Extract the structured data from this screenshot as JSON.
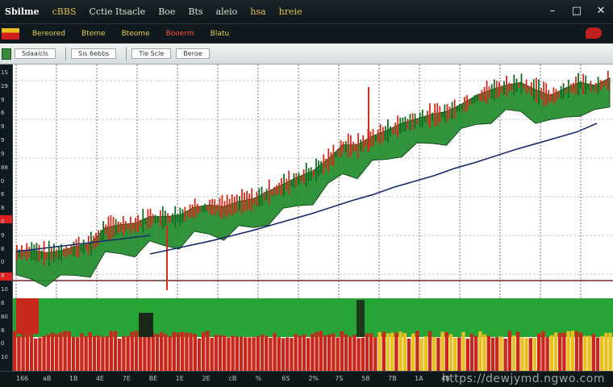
{
  "titlebar": {
    "menu": [
      "Sbilme",
      "cBBS",
      "Cctie Itsacle",
      "Boe",
      "Bts",
      "aleio",
      "hsa",
      "hreie"
    ],
    "controls": [
      "–",
      "□",
      "✕"
    ]
  },
  "toolbar1": {
    "items": [
      "Bereored",
      "Bteme",
      "Bteome",
      "Booerm",
      "Blatu"
    ],
    "icons": [
      "chart-color-swatch-icon",
      "close-panel-icon"
    ]
  },
  "toolbar2": {
    "fields": [
      "Sdaalcls",
      "Sis 6ebbs",
      "Tie Scle",
      "Beroe"
    ]
  },
  "yaxis": {
    "labels": [
      "1S",
      "29",
      "9",
      "6",
      "9",
      "9",
      "9",
      "88",
      "0",
      "6",
      "8",
      "0",
      "9",
      "8",
      "0",
      "8",
      "10",
      "8",
      "80",
      "8",
      "0",
      "10"
    ]
  },
  "xaxis": {
    "labels": [
      "166",
      "aB",
      "1B",
      "4E",
      "7E",
      "BE",
      "1E",
      "2E",
      "cB",
      "%",
      "6S",
      "2%",
      "7S",
      "58",
      "7B",
      "1A",
      "4B"
    ]
  },
  "watermark": "https://dewjymd.ngwo.com",
  "colors": {
    "up": "#d42a1c",
    "down": "#1f8a2a",
    "band": "#27a436",
    "line": "#1a2a6a",
    "volume_red": "#c8281c",
    "volume_yellow": "#e8c020"
  },
  "chart_data": {
    "type": "line",
    "series": [
      {
        "values": [
          30,
          31,
          27,
          30,
          36,
          40,
          62,
          66,
          68,
          77,
          77,
          79,
          90,
          93,
          91,
          98,
          102,
          112,
          122,
          132,
          140,
          156,
          176,
          176,
          188,
          196,
          206,
          212,
          218,
          222,
          232,
          244,
          252,
          258,
          262,
          252,
          244,
          254,
          262,
          258,
          268
        ]
      },
      {
        "values": [
          30,
          36,
          42,
          48,
          55,
          62,
          70,
          78,
          86,
          95,
          104,
          112,
          122,
          130,
          138,
          148,
          156,
          165,
          174,
          182,
          190,
          198,
          210
        ]
      }
    ],
    "grid": true
  }
}
